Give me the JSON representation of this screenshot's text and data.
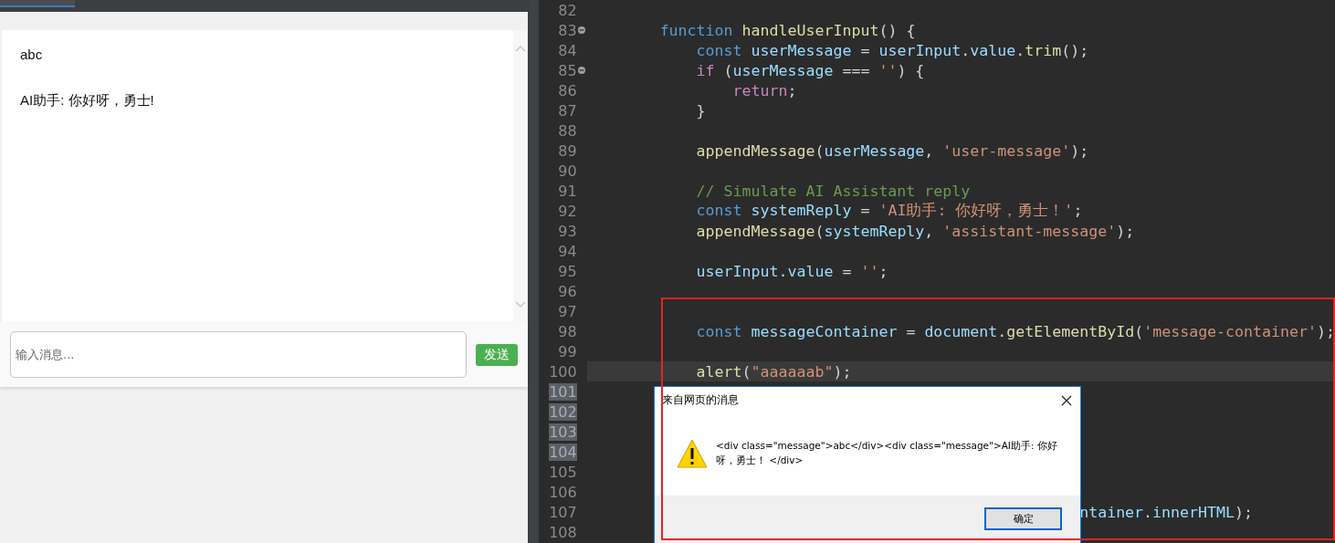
{
  "chat": {
    "messages": [
      "abc",
      "AI助手: 你好呀，勇士!"
    ],
    "input": {
      "placeholder": "输入消息..."
    },
    "send_button": "发送"
  },
  "editor": {
    "lines": [
      {
        "number": "82",
        "fold": false,
        "selected": false,
        "current": false
      },
      {
        "number": "83",
        "fold": true,
        "selected": false,
        "current": false,
        "tokens": [
          {
            "kind": "keyword",
            "text": "        function "
          },
          {
            "kind": "func",
            "text": "handleUserInput"
          },
          {
            "kind": "plain",
            "text": "() {"
          }
        ]
      },
      {
        "number": "84",
        "fold": false,
        "selected": false,
        "current": false,
        "tokens": [
          {
            "kind": "keyword",
            "text": "            const "
          },
          {
            "kind": "var",
            "text": "userMessage"
          },
          {
            "kind": "plain",
            "text": " = "
          },
          {
            "kind": "var",
            "text": "userInput"
          },
          {
            "kind": "plain",
            "text": "."
          },
          {
            "kind": "var",
            "text": "value"
          },
          {
            "kind": "plain",
            "text": "."
          },
          {
            "kind": "func",
            "text": "trim"
          },
          {
            "kind": "plain",
            "text": "();"
          }
        ]
      },
      {
        "number": "85",
        "fold": true,
        "selected": false,
        "current": false,
        "tokens": [
          {
            "kind": "control",
            "text": "            if"
          },
          {
            "kind": "plain",
            "text": " ("
          },
          {
            "kind": "var",
            "text": "userMessage"
          },
          {
            "kind": "plain",
            "text": " === "
          },
          {
            "kind": "string",
            "text": "''"
          },
          {
            "kind": "plain",
            "text": ") {"
          }
        ]
      },
      {
        "number": "86",
        "fold": false,
        "selected": false,
        "current": false,
        "tokens": [
          {
            "kind": "control",
            "text": "                return"
          },
          {
            "kind": "plain",
            "text": ";"
          }
        ]
      },
      {
        "number": "87",
        "fold": false,
        "selected": false,
        "current": false,
        "tokens": [
          {
            "kind": "plain",
            "text": "            }"
          }
        ]
      },
      {
        "number": "88",
        "fold": false,
        "selected": false,
        "current": false
      },
      {
        "number": "89",
        "fold": false,
        "selected": false,
        "current": false,
        "tokens": [
          {
            "kind": "func",
            "text": "            appendMessage"
          },
          {
            "kind": "plain",
            "text": "("
          },
          {
            "kind": "var",
            "text": "userMessage"
          },
          {
            "kind": "plain",
            "text": ", "
          },
          {
            "kind": "string",
            "text": "'user-message'"
          },
          {
            "kind": "plain",
            "text": ");"
          }
        ]
      },
      {
        "number": "90",
        "fold": false,
        "selected": false,
        "current": false
      },
      {
        "number": "91",
        "fold": false,
        "selected": false,
        "current": false,
        "tokens": [
          {
            "kind": "comment",
            "text": "            // Simulate AI Assistant reply"
          }
        ]
      },
      {
        "number": "92",
        "fold": false,
        "selected": false,
        "current": false,
        "tokens": [
          {
            "kind": "keyword",
            "text": "            const "
          },
          {
            "kind": "var",
            "text": "systemReply"
          },
          {
            "kind": "plain",
            "text": " = "
          },
          {
            "kind": "string",
            "text": "'AI助手: 你好呀，勇士！'"
          },
          {
            "kind": "plain",
            "text": ";"
          }
        ]
      },
      {
        "number": "93",
        "fold": false,
        "selected": false,
        "current": false,
        "tokens": [
          {
            "kind": "func",
            "text": "            appendMessage"
          },
          {
            "kind": "plain",
            "text": "("
          },
          {
            "kind": "var",
            "text": "systemReply"
          },
          {
            "kind": "plain",
            "text": ", "
          },
          {
            "kind": "string",
            "text": "'assistant-message'"
          },
          {
            "kind": "plain",
            "text": ");"
          }
        ]
      },
      {
        "number": "94",
        "fold": false,
        "selected": false,
        "current": false
      },
      {
        "number": "95",
        "fold": false,
        "selected": false,
        "current": false,
        "tokens": [
          {
            "kind": "var",
            "text": "            userInput"
          },
          {
            "kind": "plain",
            "text": "."
          },
          {
            "kind": "var",
            "text": "value"
          },
          {
            "kind": "plain",
            "text": " = "
          },
          {
            "kind": "string",
            "text": "''"
          },
          {
            "kind": "plain",
            "text": ";"
          }
        ]
      },
      {
        "number": "96",
        "fold": false,
        "selected": false,
        "current": false
      },
      {
        "number": "97",
        "fold": false,
        "selected": false,
        "current": false
      },
      {
        "number": "98",
        "fold": false,
        "selected": false,
        "current": false,
        "tokens": [
          {
            "kind": "keyword",
            "text": "            const "
          },
          {
            "kind": "var",
            "text": "messageContainer"
          },
          {
            "kind": "plain",
            "text": " = "
          },
          {
            "kind": "var",
            "text": "document"
          },
          {
            "kind": "plain",
            "text": "."
          },
          {
            "kind": "func",
            "text": "getElementById"
          },
          {
            "kind": "plain",
            "text": "("
          },
          {
            "kind": "string",
            "text": "'message-container'"
          },
          {
            "kind": "plain",
            "text": ");"
          }
        ]
      },
      {
        "number": "99",
        "fold": false,
        "selected": false,
        "current": false
      },
      {
        "number": "100",
        "fold": false,
        "selected": false,
        "current": true,
        "tokens": [
          {
            "kind": "func",
            "text": "            alert"
          },
          {
            "kind": "plain",
            "text": "("
          },
          {
            "kind": "string",
            "text": "\"aaaaaab\""
          },
          {
            "kind": "plain",
            "text": ");"
          }
        ]
      },
      {
        "number": "101",
        "fold": false,
        "selected": true,
        "current": false
      },
      {
        "number": "102",
        "fold": false,
        "selected": true,
        "current": false
      },
      {
        "number": "103",
        "fold": false,
        "selected": true,
        "current": false
      },
      {
        "number": "104",
        "fold": false,
        "selected": true,
        "current": false
      },
      {
        "number": "105",
        "fold": false,
        "selected": false,
        "current": false
      },
      {
        "number": "106",
        "fold": false,
        "selected": false,
        "current": false
      },
      {
        "number": "107",
        "fold": false,
        "selected": false,
        "current": false,
        "tokens": [
          {
            "kind": "var",
            "text": "                                                      ntainer"
          },
          {
            "kind": "plain",
            "text": "."
          },
          {
            "kind": "var",
            "text": "innerHTML"
          },
          {
            "kind": "plain",
            "text": ");"
          }
        ]
      },
      {
        "number": "108",
        "fold": false,
        "selected": false,
        "current": false
      }
    ]
  },
  "dialog": {
    "title": "来自网页的消息",
    "message": "<div class=\"message\">abc</div><div class=\"message\">AI助手: 你好呀，勇士！ </div>",
    "ok_button": "确定"
  }
}
